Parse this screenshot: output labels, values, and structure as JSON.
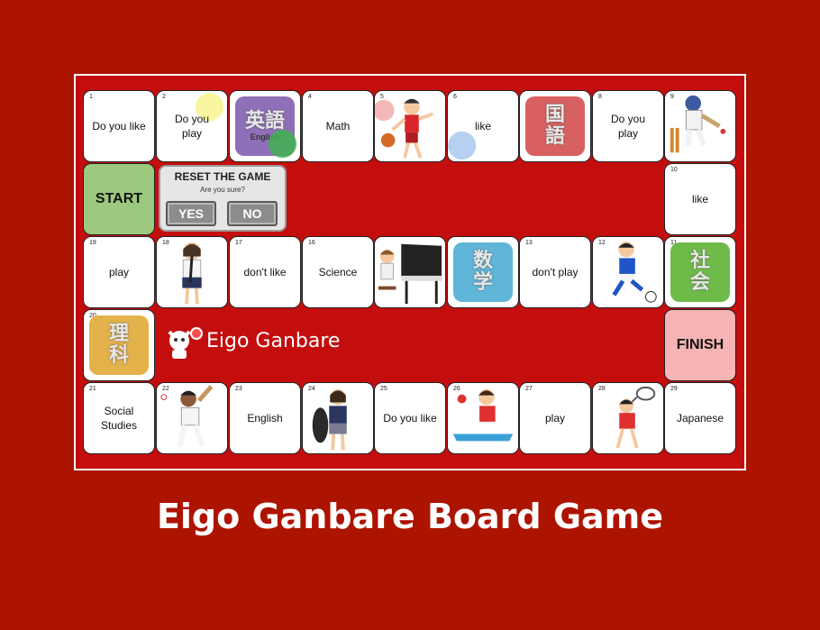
{
  "colors": {
    "page_bg": "#ad1400",
    "board_bg": "#c40e0e",
    "start": "#9cc97e",
    "finish": "#f6b4b4"
  },
  "board": {
    "start_label": "START",
    "finish_label": "FINISH",
    "cells": {
      "c1": {
        "num": "1",
        "text": "Do you like"
      },
      "c2": {
        "num": "2",
        "text": "Do you play"
      },
      "c3": {
        "kanji": "英語",
        "sub": "English"
      },
      "c4": {
        "num": "4",
        "text": "Math"
      },
      "c5": {
        "num": "5"
      },
      "c6": {
        "num": "6",
        "text": "like"
      },
      "c7": {
        "kanji": "国語"
      },
      "c8": {
        "num": "8",
        "text": "Do you play"
      },
      "c9": {
        "num": "9"
      },
      "c10": {
        "num": "10",
        "text": "like"
      },
      "c11": {
        "num": "11",
        "kanji": "社会"
      },
      "c12": {
        "num": "12"
      },
      "c13": {
        "num": "13",
        "text": "don't play"
      },
      "c14": {
        "kanji": "数学"
      },
      "c15": {},
      "c16": {
        "num": "16",
        "text": "Science"
      },
      "c17": {
        "num": "17",
        "text": "don't like"
      },
      "c18": {
        "num": "18"
      },
      "c19": {
        "num": "19",
        "text": "play"
      },
      "c20": {
        "num": "20",
        "kanji": "理科"
      },
      "c21": {
        "num": "21",
        "text": "Social Studies"
      },
      "c22": {
        "num": "22"
      },
      "c23": {
        "num": "23",
        "text": "English"
      },
      "c24": {
        "num": "24"
      },
      "c25": {
        "num": "25",
        "text": "Do you like"
      },
      "c26": {
        "num": "26"
      },
      "c27": {
        "num": "27",
        "text": "play"
      },
      "c28": {
        "num": "28"
      },
      "c29": {
        "num": "29",
        "text": "Japanese"
      }
    }
  },
  "reset": {
    "title": "RESET THE GAME",
    "subtitle": "Are you sure?",
    "yes": "YES",
    "no": "NO"
  },
  "logo": {
    "text": "Eigo Ganbare"
  },
  "title": "Eigo Ganbare Board Game"
}
